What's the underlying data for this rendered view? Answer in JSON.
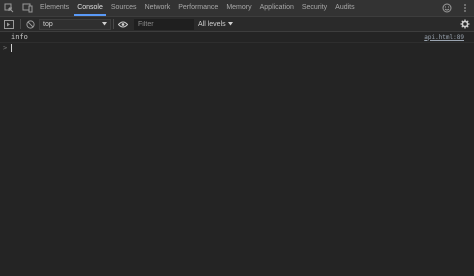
{
  "tabs": [
    "Elements",
    "Console",
    "Sources",
    "Network",
    "Performance",
    "Memory",
    "Application",
    "Security",
    "Audits"
  ],
  "active_tab": "Console",
  "toolbar": {
    "context_value": "top",
    "filter_placeholder": "Filter",
    "levels_label": "All levels"
  },
  "console": {
    "rows": [
      {
        "message": "info",
        "source": "api.html:89"
      }
    ],
    "prompt_symbol": ">"
  },
  "colors": {
    "accent": "#5a9af7",
    "background": "#242424",
    "tabbar": "#333333"
  },
  "icons": [
    "inspect-element-icon",
    "device-toolbar-icon",
    "smiley-feedback-icon",
    "more-vert-icon",
    "sidebar-toggle-icon",
    "clear-console-icon",
    "eye-icon",
    "settings-gear-icon",
    "chevron-down-icon",
    "prompt-chevron-icon"
  ]
}
